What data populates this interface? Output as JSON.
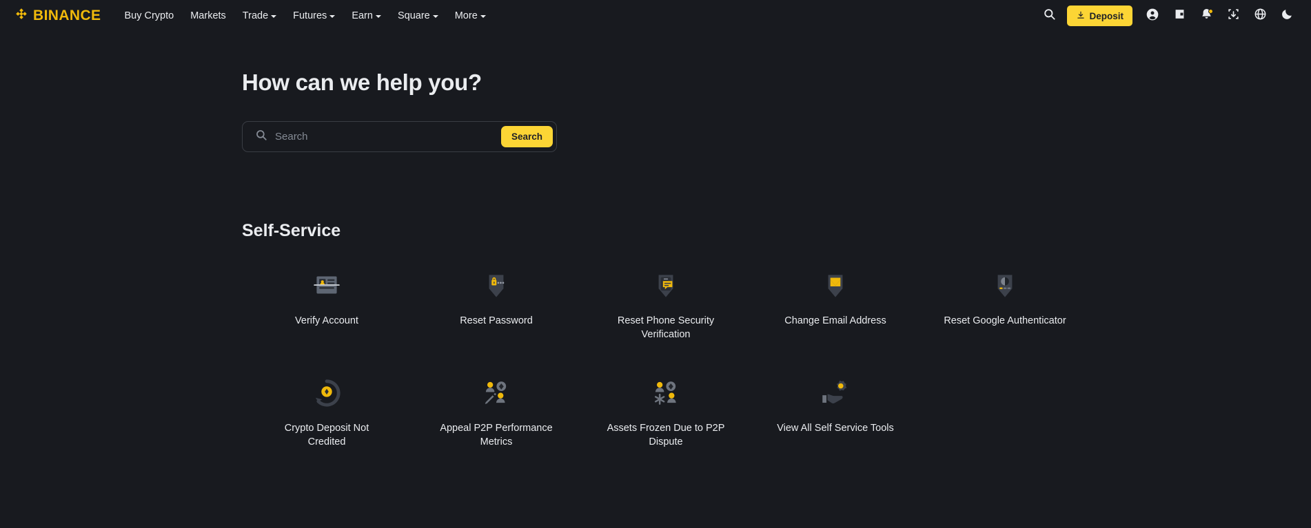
{
  "header": {
    "logo_text": "BINANCE",
    "logo_icon": "binance-diamond-logo",
    "nav": [
      {
        "label": "Buy Crypto",
        "has_caret": false
      },
      {
        "label": "Markets",
        "has_caret": false
      },
      {
        "label": "Trade",
        "has_caret": true
      },
      {
        "label": "Futures",
        "has_caret": true
      },
      {
        "label": "Earn",
        "has_caret": true
      },
      {
        "label": "Square",
        "has_caret": true
      },
      {
        "label": "More",
        "has_caret": true
      }
    ],
    "search_icon": "search-icon",
    "deposit_label": "Deposit",
    "deposit_icon": "download-icon",
    "right_icons": [
      {
        "name": "user-profile-icon"
      },
      {
        "name": "wallet-icon"
      },
      {
        "name": "notifications-bell-icon"
      },
      {
        "name": "download-app-icon"
      },
      {
        "name": "language-globe-icon"
      },
      {
        "name": "dark-mode-moon-icon"
      }
    ]
  },
  "main": {
    "page_title": "How can we help you?",
    "search": {
      "placeholder": "Search",
      "value": "",
      "button_label": "Search",
      "icon": "search-icon"
    },
    "section_title": "Self-Service",
    "tiles": [
      {
        "label": "Verify Account",
        "icon": "id-card-verify-icon"
      },
      {
        "label": "Reset Password",
        "icon": "shield-lock-icon"
      },
      {
        "label": "Reset Phone Security Verification",
        "icon": "shield-phone-message-icon"
      },
      {
        "label": "Change Email Address",
        "icon": "shield-envelope-icon"
      },
      {
        "label": "Reset Google Authenticator",
        "icon": "shield-authenticator-icon"
      },
      {
        "label": "Crypto Deposit Not Credited",
        "icon": "refresh-coin-icon"
      },
      {
        "label": "Appeal P2P Performance Metrics",
        "icon": "people-pencil-icon"
      },
      {
        "label": "Assets Frozen Due to P2P Dispute",
        "icon": "people-snowflake-icon"
      },
      {
        "label": "View All Self Service Tools",
        "icon": "hand-gear-icon"
      }
    ]
  },
  "colors": {
    "background": "#181a1f",
    "accent_yellow": "#f0b90b",
    "button_yellow": "#fcd535",
    "text_primary": "#eaecef",
    "text_muted": "#858b95",
    "icon_gray": "#5e6673",
    "icon_dark": "#2b2f36"
  }
}
